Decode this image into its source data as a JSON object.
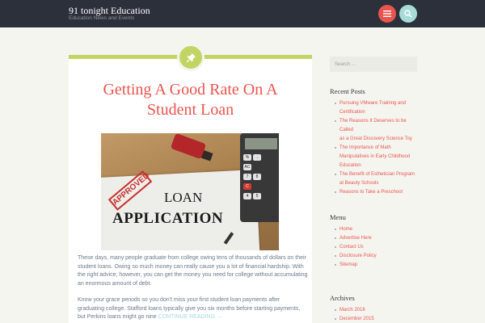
{
  "site": {
    "title": "91 tonight Education",
    "description": "Education News and Events"
  },
  "header": {
    "menu_icon": "menu-icon",
    "search_icon": "search-icon",
    "menu_color": "#e8554e",
    "search_color": "#a7dbd8"
  },
  "post": {
    "format_icon": "pin-icon",
    "title_line1": "Getting A Good Rate On A",
    "title_line2": "Student Loan",
    "image": {
      "stamp_text": "APPROVED",
      "line1": "LOAN",
      "line2": "APPLICATION",
      "calc_keys": [
        "%",
        "→",
        "AC",
        "7",
        "8",
        "C",
        "4",
        "5"
      ]
    },
    "paragraph1": "These days, many people graduate from college owing tens of thousands of dollars on their student loans. Owing so much money can really cause you a lot of financial hardship. With the right advice, however, you can get the money you need for college without accumulating an enormous amount of debt.",
    "paragraph2": "Know your grace periods so you don't miss your first student loan payments after graduating college. Stafford loans typically give you six months before starting payments, but Perkins loans might go nine",
    "continue_label": "CONTINUE READING →"
  },
  "sidebar": {
    "search_placeholder": "Search …",
    "recent_posts": {
      "title": "Recent Posts",
      "items": [
        "Pursuing VMware Training and",
        "Certification",
        "The Reasons It Deserves to be Called",
        "as a Great Discovery Science Toy",
        "The Importance of Math",
        "Manipulatives in Early Childhood",
        "Education",
        "The Benefit of Esthetician Program",
        "at Beauty Schools",
        "Reasons to Take a Preschool"
      ],
      "bullets_on": [
        0,
        2,
        4,
        7,
        9
      ]
    },
    "menu": {
      "title": "Menu",
      "items": [
        "Home",
        "Advertise Here",
        "Contact Us",
        "Disclosure Policy",
        "Sitemap"
      ]
    },
    "archives": {
      "title": "Archives",
      "items": [
        "March 2016",
        "December 2015"
      ]
    }
  },
  "colors": {
    "accent_red": "#e8554e",
    "accent_green": "#c2d563",
    "accent_teal": "#a7dbd8",
    "header_bg": "#2b303a"
  }
}
